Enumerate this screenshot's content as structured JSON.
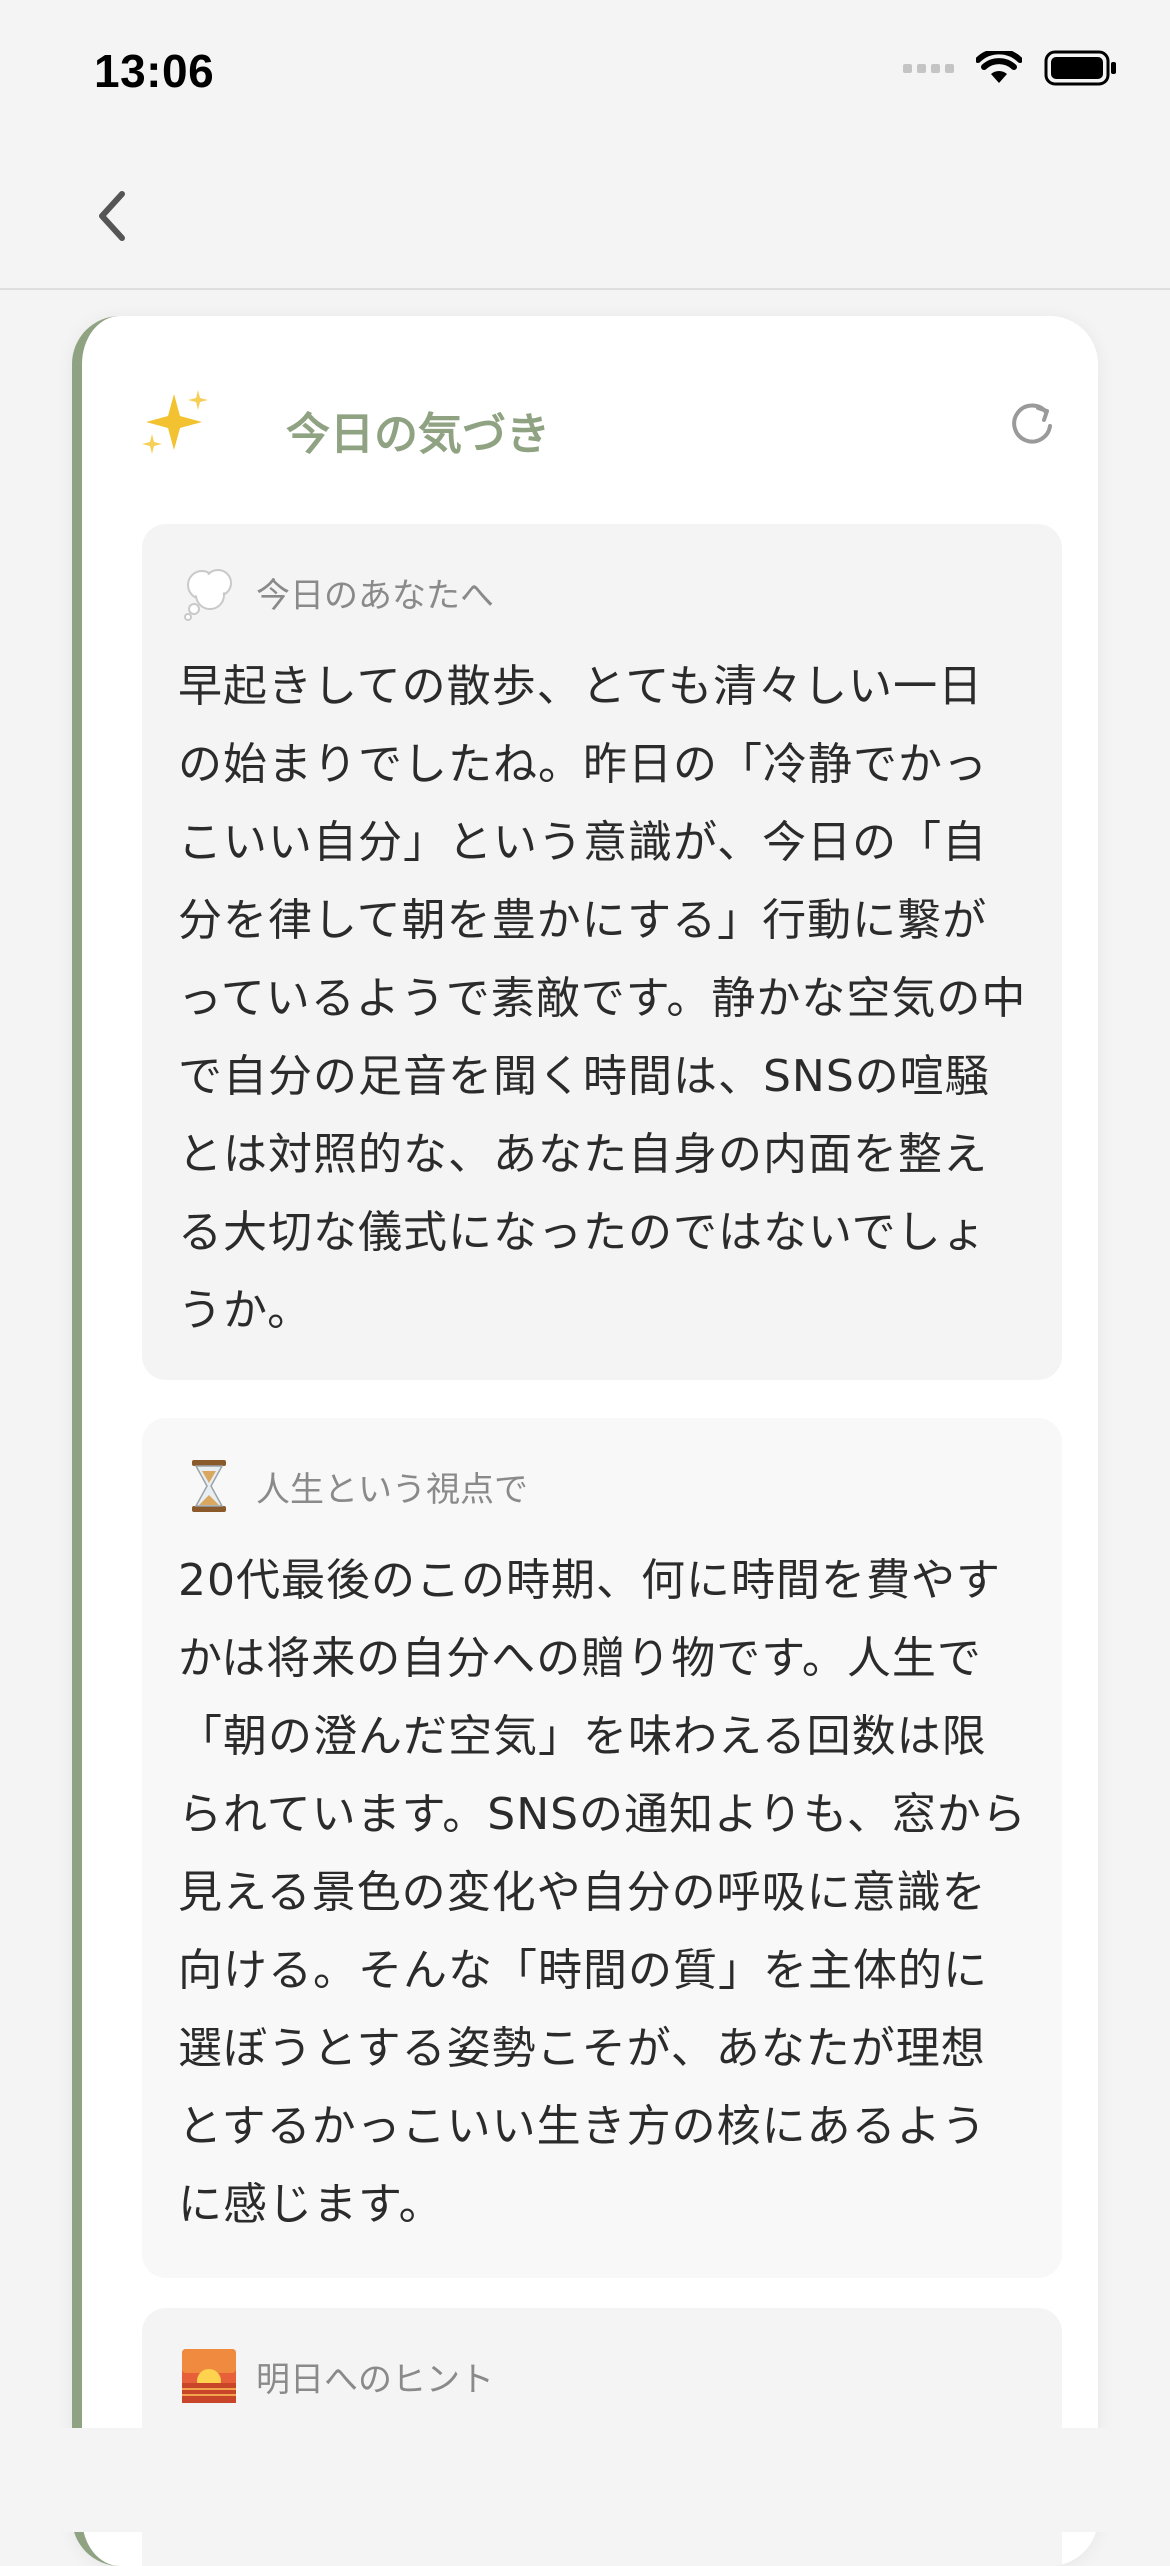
{
  "status_bar": {
    "time": "13:06"
  },
  "card": {
    "title": "今日の気づき",
    "sections": [
      {
        "icon": "thought-bubble-icon",
        "label": "今日のあなたへ",
        "text": "早起きしての散歩、とても清々しい一日の始まりでしたね。昨日の「冷静でかっこいい自分」という意識が、今日の「自分を律して朝を豊かにする」行動に繋がっているようで素敵です。静かな空気の中で自分の足音を聞く時間は、SNSの喧騒とは対照的な、あなた自身の内面を整える大切な儀式になったのではないでしょうか。"
      },
      {
        "icon": "hourglass-icon",
        "label": "人生という視点で",
        "text": "20代最後のこの時期、何に時間を費やすかは将来の自分への贈り物です。人生で「朝の澄んだ空気」を味わえる回数は限られています。SNSの通知よりも、窓から見える景色の変化や自分の呼吸に意識を向ける。そんな「時間の質」を主体的に選ぼうとする姿勢こそが、あなたが理想とするかっこいい生き方の核にあるように感じます。"
      },
      {
        "icon": "sunrise-icon",
        "label": "明日へのヒント",
        "text": ""
      }
    ]
  },
  "colors": {
    "accent": "#8fa383",
    "card_background": "#ffffff",
    "section_background": "#f4f4f4",
    "page_background": "#f4f4f4"
  }
}
